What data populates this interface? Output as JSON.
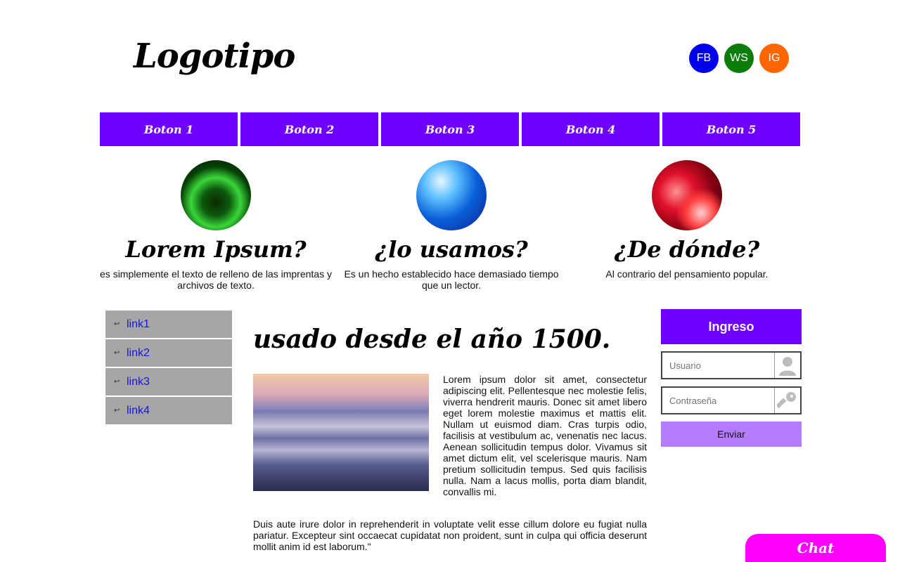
{
  "header": {
    "logo": "Logotipo",
    "social": [
      {
        "label": "FB",
        "color": "#0000ee"
      },
      {
        "label": "WS",
        "color": "#0a7d0a"
      },
      {
        "label": "IG",
        "color": "#ff6600"
      }
    ]
  },
  "nav": {
    "color": "#6e00ff",
    "buttons": [
      "Boton 1",
      "Boton 2",
      "Boton 3",
      "Boton 4",
      "Boton 5"
    ]
  },
  "features": [
    {
      "title": "Lorem Ipsum?",
      "text": "es simplemente el texto de relleno de las imprentas y archivos de texto.",
      "image": "green-tunnel-image"
    },
    {
      "title": "¿lo usamos?",
      "text": "Es un hecho establecido hace demasiado tiempo que un lector.",
      "image": "blue-abstract-image"
    },
    {
      "title": "¿De dónde?",
      "text": "Al contrario del pensamiento popular.",
      "image": "red-bokeh-image"
    }
  ],
  "sidebar": {
    "color": "#a6a6a6",
    "links": [
      "link1",
      "link2",
      "link3",
      "link4"
    ]
  },
  "main": {
    "heading": "usado desde el año 1500.",
    "image": "misty-mountains-photo",
    "paragraph1": "Lorem ipsum dolor sit amet, consectetur adipiscing elit. Pellentesque nec molestie felis, viverra hendrerit mauris. Donec sit amet libero eget lorem molestie maximus et mattis elit. Nullam ut euismod diam. Cras turpis odio, facilisis at vestibulum ac, venenatis nec lacus. Aenean sollicitudin tempus dolor. Vivamus sit amet dictum elit, vel scelerisque mauris. Nam pretium sollicitudin tempus. Sed quis facilisis nulla. Nam a lacus mollis, porta diam blandit, convallis mi.",
    "paragraph2": "Duis aute irure dolor in reprehenderit in voluptate velit esse cillum dolore eu fugiat nulla pariatur. Excepteur sint occaecat cupidatat non proident, sunt in culpa qui officia deserunt mollit anim id est laborum.\""
  },
  "login": {
    "title": "Ingreso",
    "title_color": "#6e00ff",
    "user_placeholder": "Usuario",
    "user_icon": "user-icon",
    "password_placeholder": "Contraseña",
    "password_icon": "key-icon",
    "submit": "Enviar",
    "submit_color": "#b57cff"
  },
  "chat": {
    "label": "Chat",
    "color": "#ff00ff"
  }
}
